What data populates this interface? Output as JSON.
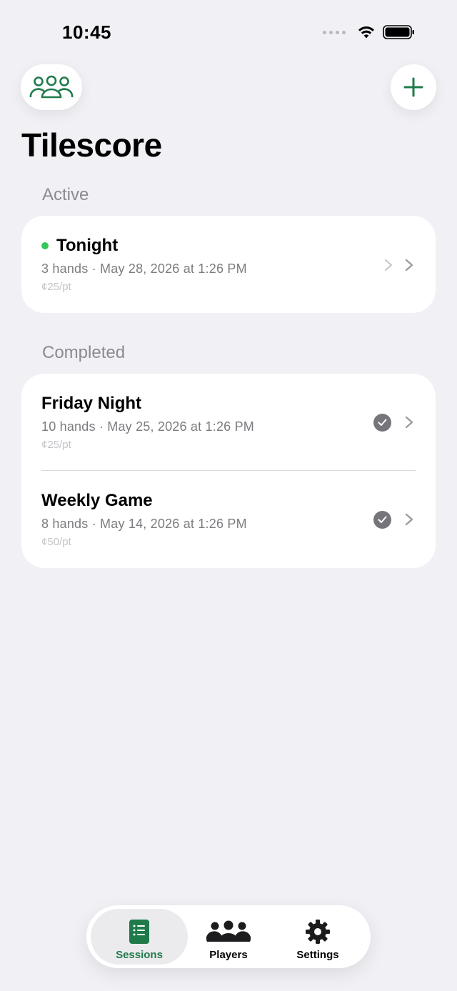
{
  "status_bar": {
    "time": "10:45"
  },
  "header": {
    "title": "Tilescore",
    "players_button_icon": "people-icon",
    "add_button_icon": "plus-icon"
  },
  "sections": {
    "active": {
      "label": "Active",
      "items": [
        {
          "title": "Tonight",
          "subtitle": "3 hands · May 28, 2026 at 1:26 PM",
          "rate": "¢25/pt",
          "status": "live"
        }
      ]
    },
    "completed": {
      "label": "Completed",
      "items": [
        {
          "title": "Friday Night",
          "subtitle": "10 hands · May 25, 2026 at 1:26 PM",
          "rate": "¢25/pt",
          "status": "completed"
        },
        {
          "title": "Weekly Game",
          "subtitle": "8 hands · May 14, 2026 at 1:26 PM",
          "rate": "¢50/pt",
          "status": "completed"
        }
      ]
    }
  },
  "tab_bar": {
    "tabs": [
      {
        "label": "Sessions",
        "icon": "list-icon",
        "active": true
      },
      {
        "label": "Players",
        "icon": "people-icon",
        "active": false
      },
      {
        "label": "Settings",
        "icon": "gear-icon",
        "active": false
      }
    ]
  },
  "colors": {
    "accent": "#1f7a4a",
    "live": "#34c759",
    "background": "#f0f0f5"
  }
}
